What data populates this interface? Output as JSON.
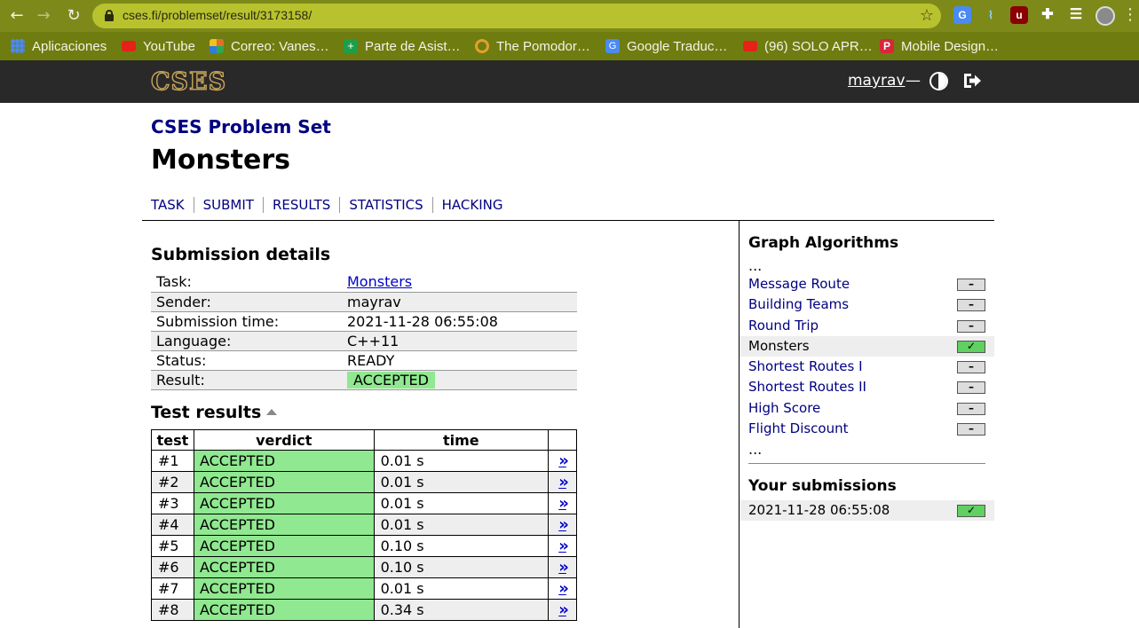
{
  "browser": {
    "url": "cses.fi/problemset/result/3173158/",
    "bookmarks": [
      {
        "label": "Aplicaciones",
        "icon": "apps-grid-icon",
        "color": "#4a8af4"
      },
      {
        "label": "YouTube",
        "icon": "youtube-icon",
        "color": "#e62117"
      },
      {
        "label": "Correo: Vanes…",
        "icon": "outlook-icon",
        "color": "#e0702a"
      },
      {
        "label": "Parte de Asist…",
        "icon": "sheets-plus-icon",
        "color": "#1e9e4a"
      },
      {
        "label": "The Pomodor…",
        "icon": "pomodoro-icon",
        "color": "#e2a12a"
      },
      {
        "label": "Google Traduc…",
        "icon": "google-translate-icon",
        "color": "#4a8af4"
      },
      {
        "label": "(96) SOLO APR…",
        "icon": "youtube-icon",
        "color": "#e62117"
      },
      {
        "label": "Mobile Design…",
        "icon": "pinterest-p-icon",
        "color": "#d8263c"
      }
    ]
  },
  "site": {
    "logo": "CSES",
    "username": "mayrav",
    "dash": "—"
  },
  "page": {
    "set_title": "CSES Problem Set",
    "task_title": "Monsters",
    "tabs": [
      "TASK",
      "SUBMIT",
      "RESULTS",
      "STATISTICS",
      "HACKING"
    ]
  },
  "submission": {
    "heading": "Submission details",
    "rows": [
      {
        "key": "Task:",
        "value": "Monsters"
      },
      {
        "key": "Sender:",
        "value": "mayrav"
      },
      {
        "key": "Submission time:",
        "value": "2021-11-28 06:55:08"
      },
      {
        "key": "Language:",
        "value": "C++11"
      },
      {
        "key": "Status:",
        "value": "READY"
      },
      {
        "key": "Result:",
        "value": "ACCEPTED"
      }
    ]
  },
  "tests": {
    "heading": "Test results",
    "columns": [
      "test",
      "verdict",
      "time"
    ],
    "view_label": "»",
    "rows": [
      {
        "test": "#1",
        "verdict": "ACCEPTED",
        "time": "0.01 s"
      },
      {
        "test": "#2",
        "verdict": "ACCEPTED",
        "time": "0.01 s"
      },
      {
        "test": "#3",
        "verdict": "ACCEPTED",
        "time": "0.01 s"
      },
      {
        "test": "#4",
        "verdict": "ACCEPTED",
        "time": "0.01 s"
      },
      {
        "test": "#5",
        "verdict": "ACCEPTED",
        "time": "0.10 s"
      },
      {
        "test": "#6",
        "verdict": "ACCEPTED",
        "time": "0.10 s"
      },
      {
        "test": "#7",
        "verdict": "ACCEPTED",
        "time": "0.01 s"
      },
      {
        "test": "#8",
        "verdict": "ACCEPTED",
        "time": "0.34 s"
      }
    ]
  },
  "sidebar": {
    "section_title": "Graph Algorithms",
    "ellipsis": "...",
    "items": [
      {
        "label": "Message Route",
        "status": "–"
      },
      {
        "label": "Building Teams",
        "status": "–"
      },
      {
        "label": "Round Trip",
        "status": "–"
      },
      {
        "label": "Monsters",
        "status": "✓"
      },
      {
        "label": "Shortest Routes I",
        "status": "–"
      },
      {
        "label": "Shortest Routes II",
        "status": "–"
      },
      {
        "label": "High Score",
        "status": "–"
      },
      {
        "label": "Flight Discount",
        "status": "–"
      }
    ],
    "submissions_title": "Your submissions",
    "submissions": [
      {
        "time": "2021-11-28 06:55:08",
        "status": "✓"
      }
    ]
  },
  "colors": {
    "accepted": "#90e890",
    "header_bg": "#292929",
    "link": "#000080",
    "logo": "#c8a55a"
  }
}
